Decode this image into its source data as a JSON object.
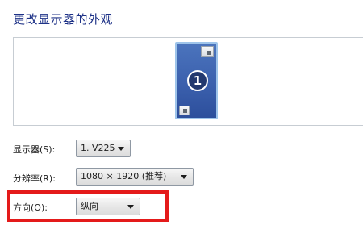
{
  "page": {
    "title": "更改显示器的外观"
  },
  "preview": {
    "monitor_number": "1"
  },
  "display": {
    "label": "显示器(S):",
    "selected": "1. V225"
  },
  "resolution": {
    "label": "分辨率(R):",
    "selected": "1080 × 1920 (推荐)"
  },
  "orientation": {
    "label": "方向(O):",
    "selected": "纵向"
  },
  "colors": {
    "title": "#1e3287",
    "highlight": "#e41a1a",
    "monitor": "#3b60ad"
  },
  "icons": [
    "window-thumbnail-icon",
    "chevron-down-icon"
  ]
}
